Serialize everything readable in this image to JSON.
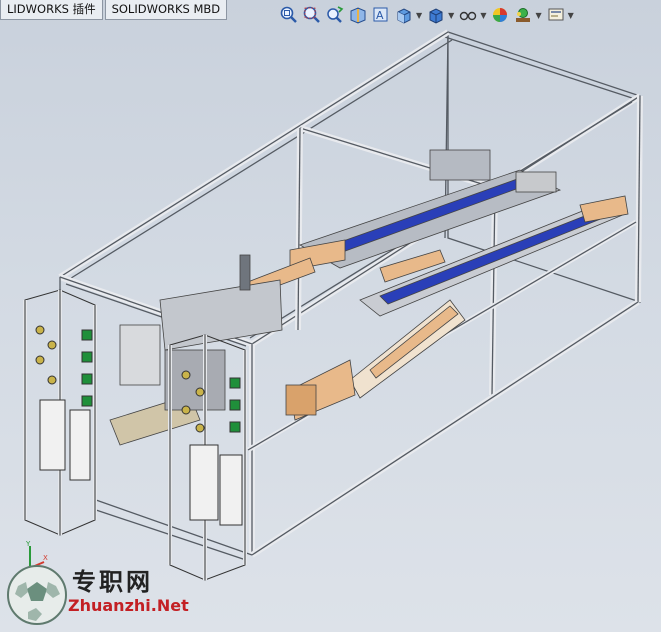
{
  "tabs": [
    {
      "label": "LIDWORKS 插件"
    },
    {
      "label": "SOLIDWORKS MBD"
    }
  ],
  "toolbar": {
    "icons": [
      "zoom-to-fit-icon",
      "zoom-to-area-icon",
      "previous-view-icon",
      "section-view-icon",
      "dynamic-annotation-icon",
      "view-orientation-icon",
      "display-style-icon",
      "hide-show-items-icon",
      "edit-appearance-icon",
      "apply-scene-icon",
      "view-settings-icon"
    ]
  },
  "watermark": {
    "chinese": "专职网",
    "url": "Zhuanzhi.Net"
  },
  "colors": {
    "frame": "#e8eaee",
    "frame_edge": "#555b63",
    "belt": "#e8b98a",
    "rail_blue": "#2a3fb8",
    "accent_green": "#1f8f3a",
    "watermark_red": "#c32024"
  }
}
